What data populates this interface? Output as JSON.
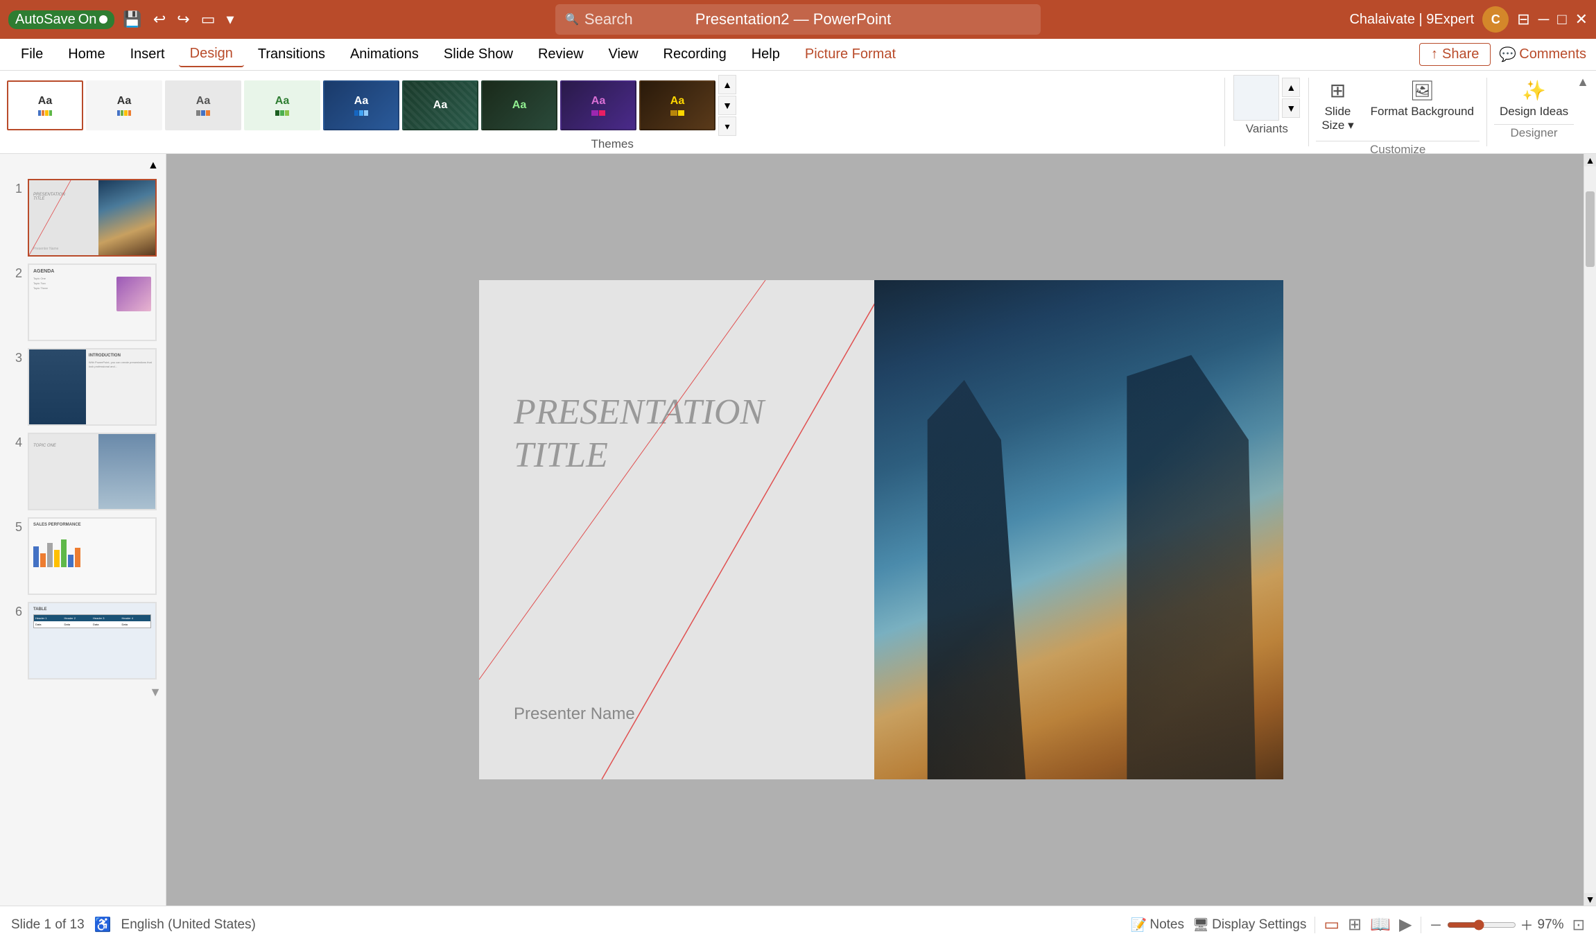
{
  "titlebar": {
    "autosave_label": "AutoSave",
    "autosave_state": "On",
    "app_title": "Presentation2 — PowerPoint",
    "user_name": "Chalaivate | 9Expert",
    "user_initial": "C"
  },
  "search": {
    "placeholder": "Search"
  },
  "menu": {
    "items": [
      {
        "label": "File",
        "active": false
      },
      {
        "label": "Home",
        "active": false
      },
      {
        "label": "Insert",
        "active": false
      },
      {
        "label": "Design",
        "active": true
      },
      {
        "label": "Transitions",
        "active": false
      },
      {
        "label": "Animations",
        "active": false
      },
      {
        "label": "Slide Show",
        "active": false
      },
      {
        "label": "Review",
        "active": false
      },
      {
        "label": "View",
        "active": false
      },
      {
        "label": "Recording",
        "active": false
      },
      {
        "label": "Help",
        "active": false
      },
      {
        "label": "Picture Format",
        "active": false,
        "highlight": true
      }
    ],
    "share_label": "Share",
    "comments_label": "Comments"
  },
  "ribbon": {
    "themes_label": "Themes",
    "variants_label": "Variants",
    "customize_label": "Customize",
    "designer_label": "Designer",
    "themes": [
      {
        "name": "default",
        "label": "Aa",
        "style": "blank"
      },
      {
        "name": "office",
        "label": "Aa",
        "style": "striped"
      },
      {
        "name": "theme3",
        "label": "Aa",
        "style": "gray"
      },
      {
        "name": "theme4",
        "label": "Aa",
        "style": "green"
      },
      {
        "name": "theme5",
        "label": "Aa",
        "style": "orange"
      },
      {
        "name": "theme6",
        "label": "Aa",
        "style": "pattern"
      },
      {
        "name": "theme7",
        "label": "Aa",
        "style": "dark"
      },
      {
        "name": "theme8",
        "label": "Aa",
        "style": "purple"
      },
      {
        "name": "theme9",
        "label": "Aa",
        "style": "gold"
      }
    ],
    "tools": [
      {
        "id": "slide-size",
        "icon": "⊞",
        "label": "Slide\nSize"
      },
      {
        "id": "format-background",
        "icon": "🖼",
        "label": "Format\nBackground"
      },
      {
        "id": "design-ideas",
        "icon": "✨",
        "label": "Design\nIdeas"
      }
    ]
  },
  "slides": [
    {
      "num": 1,
      "active": true,
      "type": "title"
    },
    {
      "num": 2,
      "active": false,
      "type": "agenda"
    },
    {
      "num": 3,
      "active": false,
      "type": "intro"
    },
    {
      "num": 4,
      "active": false,
      "type": "topic"
    },
    {
      "num": 5,
      "active": false,
      "type": "chart"
    },
    {
      "num": 6,
      "active": false,
      "type": "table"
    }
  ],
  "current_slide": {
    "title": "PRESENTATION TITLE",
    "presenter_label": "Presenter Name"
  },
  "statusbar": {
    "slide_info": "Slide 1 of 13",
    "language": "English (United States)",
    "notes_label": "Notes",
    "display_settings_label": "Display Settings",
    "zoom_percent": "97%"
  }
}
